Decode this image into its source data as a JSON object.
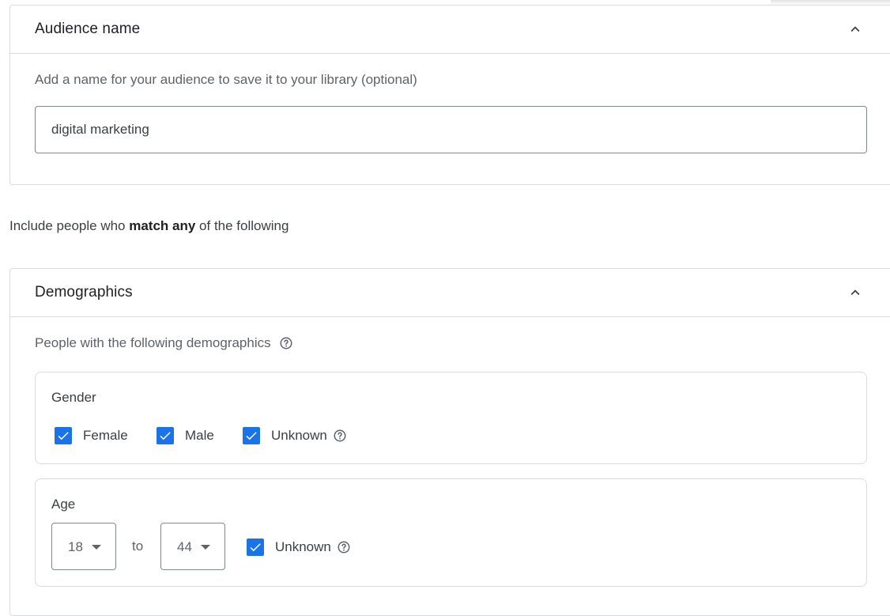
{
  "audience_name": {
    "title": "Audience name",
    "description": "Add a name for your audience to save it to your library (optional)",
    "input_value": "digital marketing"
  },
  "include": {
    "prefix": "Include people who ",
    "emphasis": "match any",
    "suffix": " of the following"
  },
  "demographics": {
    "title": "Demographics",
    "description": "People with the following demographics",
    "gender": {
      "title": "Gender",
      "options": [
        {
          "label": "Female",
          "checked": true
        },
        {
          "label": "Male",
          "checked": true
        },
        {
          "label": "Unknown",
          "checked": true
        }
      ]
    },
    "age": {
      "title": "Age",
      "from": "18",
      "to_label": "to",
      "to": "44",
      "unknown_label": "Unknown",
      "unknown_checked": true
    }
  },
  "colors": {
    "checkbox": "#1a73e8",
    "border": "#dadce0",
    "text": "#3c4043"
  }
}
